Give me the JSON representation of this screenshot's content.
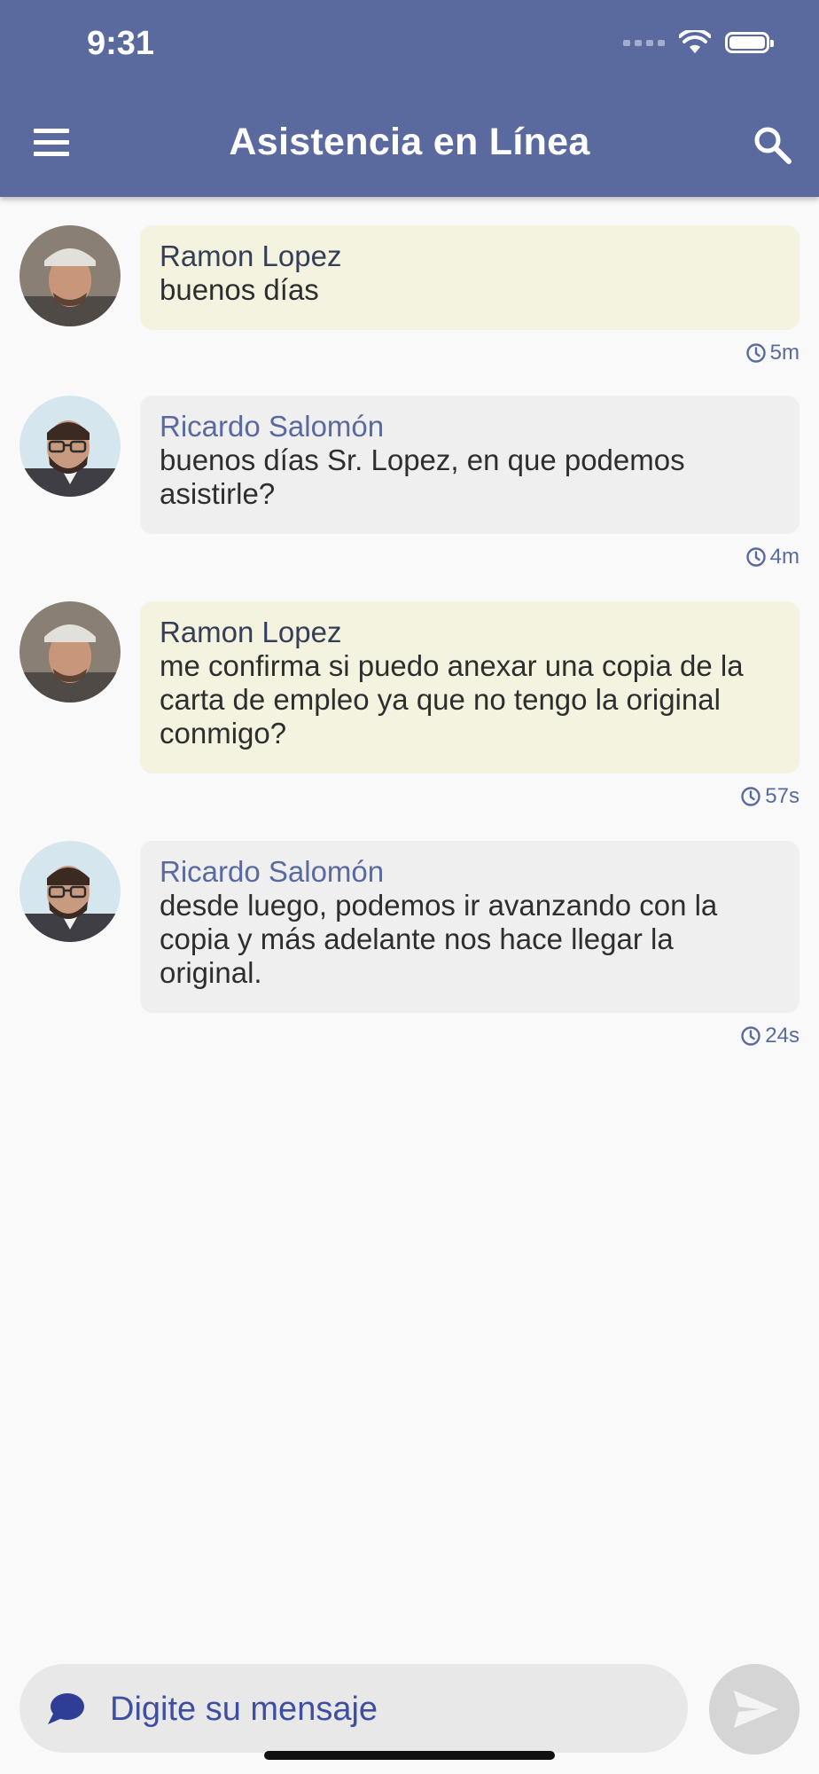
{
  "status_bar": {
    "time": "9:31"
  },
  "header": {
    "title": "Asistencia en Línea",
    "menu_icon": "hamburger-menu-icon",
    "search_icon": "search-icon"
  },
  "colors": {
    "accent": "#5a6a9f",
    "user_bubble": "#f4f3df",
    "agent_bubble": "#efefef",
    "background": "#f9f9f9"
  },
  "messages": [
    {
      "sender": "Ramon Lopez",
      "role": "user",
      "text": "buenos días",
      "time": "5m"
    },
    {
      "sender": "Ricardo Salomón",
      "role": "agent",
      "text": "buenos días Sr. Lopez, en que podemos asistirle?",
      "time": "4m"
    },
    {
      "sender": "Ramon Lopez",
      "role": "user",
      "text": "me confirma si puedo anexar una copia de la carta de empleo ya que no tengo la original conmigo?",
      "time": "57s"
    },
    {
      "sender": "Ricardo Salomón",
      "role": "agent",
      "text": "desde luego, podemos ir avanzando con la copia y más adelante nos hace llegar la original.",
      "time": "24s"
    }
  ],
  "composer": {
    "placeholder": "Digite su mensaje",
    "value": ""
  }
}
